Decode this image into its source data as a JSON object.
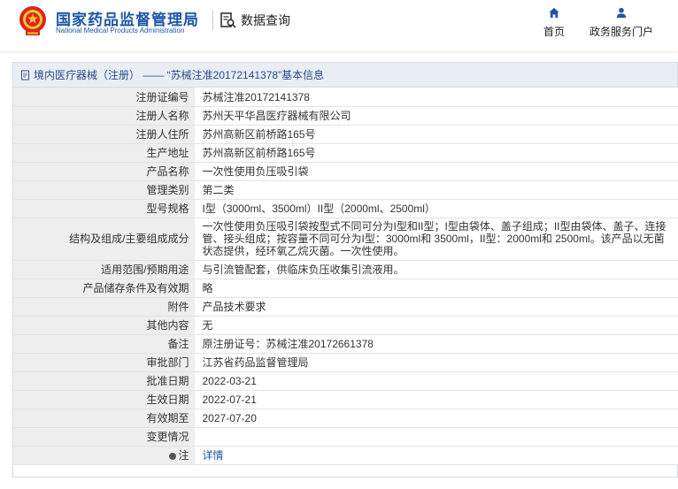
{
  "header": {
    "brand_cn": "国家药品监督管理局",
    "brand_en": "National Medical Products Administration",
    "query_label": "数据查询",
    "nav": [
      {
        "label": "首页",
        "icon": "home-icon"
      },
      {
        "label": "政务服务门户",
        "icon": "user-icon"
      }
    ]
  },
  "breadcrumb": {
    "text": "境内医疗器械（注册） —— “苏械注准20172141378”基本信息"
  },
  "fields": [
    {
      "label": "注册证编号",
      "value": "苏械注准20172141378"
    },
    {
      "label": "注册人名称",
      "value": "苏州天平华昌医疗器械有限公司"
    },
    {
      "label": "注册人住所",
      "value": "苏州高新区前桥路165号"
    },
    {
      "label": "生产地址",
      "value": "苏州高新区前桥路165号"
    },
    {
      "label": "产品名称",
      "value": "一次性使用负压吸引袋"
    },
    {
      "label": "管理类别",
      "value": "第二类"
    },
    {
      "label": "型号规格",
      "value": "I型（3000ml、3500ml）II型（2000ml、2500ml）"
    },
    {
      "label": "结构及组成/主要组成成分",
      "value": "一次性使用负压吸引袋按型式不同可分为I型和II型；I型由袋体、盖子组成；II型由袋体、盖子、连接管、接头组成；按容量不同可分为I型：3000ml和 3500ml，II型：2000ml和 2500ml。该产品以无菌状态提供，经环氧乙烷灭菌。一次性使用。"
    },
    {
      "label": "适用范围/预期用途",
      "value": "与引流管配套，供临床负压收集引流液用。"
    },
    {
      "label": "产品储存条件及有效期",
      "value": "略"
    },
    {
      "label": "附件",
      "value": "产品技术要求"
    },
    {
      "label": "其他内容",
      "value": "无"
    },
    {
      "label": "备注",
      "value": "原注册证号：苏械注准20172661378"
    },
    {
      "label": "审批部门",
      "value": "江苏省药品监督管理局"
    },
    {
      "label": "批准日期",
      "value": "2022-03-21"
    },
    {
      "label": "生效日期",
      "value": "2022-07-21"
    },
    {
      "label": "有效期至",
      "value": "2027-07-20"
    },
    {
      "label": "变更情况",
      "value": ""
    },
    {
      "label": "注",
      "value": "详情"
    }
  ],
  "colors": {
    "brand": "#1d57a5",
    "label_bg": "#eeeeee",
    "breadcrumb_bg": "#e9eef5"
  }
}
